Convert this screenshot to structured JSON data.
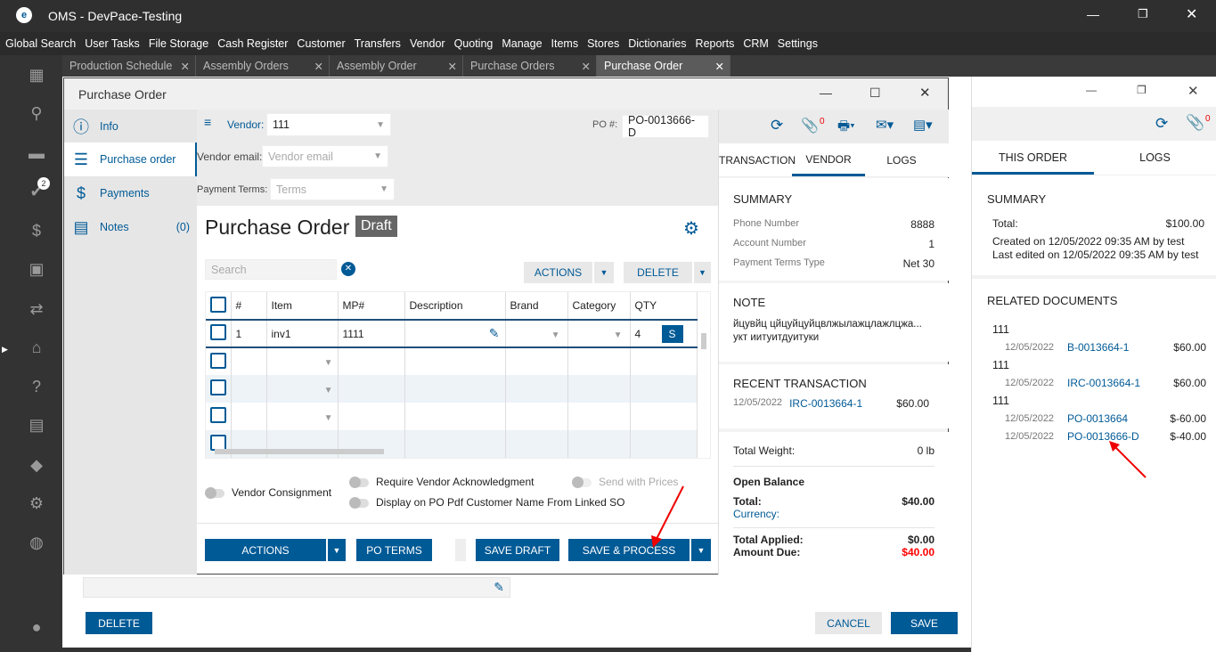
{
  "app": {
    "title": "OMS - DevPace-Testing"
  },
  "menu": [
    "Global Search",
    "User Tasks",
    "File Storage",
    "Cash Register",
    "Customer",
    "Transfers",
    "Vendor",
    "Quoting",
    "Manage",
    "Items",
    "Stores",
    "Dictionaries",
    "Reports",
    "CRM",
    "Settings"
  ],
  "tabs": [
    "Production Schedule",
    "Assembly Orders",
    "Assembly Order",
    "Purchase Orders",
    "Purchase Order"
  ],
  "notifications_badge": "2",
  "modal": {
    "title": "Purchase Order",
    "nav": {
      "info": "Info",
      "purchase_order": "Purchase order",
      "payments": "Payments",
      "notes": "Notes",
      "notes_count": "(0)"
    },
    "vendor_label": "Vendor:",
    "vendor_value": "111",
    "po_label": "PO #:",
    "po_value": "PO-0013666-D",
    "email_label": "Vendor email:",
    "email_placeholder": "Vendor email",
    "terms_label": "Payment Terms:",
    "terms_placeholder": "Terms",
    "heading": "Purchase Order",
    "status": "Draft",
    "search_placeholder": "Search",
    "actions": "ACTIONS",
    "delete": "DELETE",
    "columns": [
      "#",
      "Item",
      "MP#",
      "Description",
      "Brand",
      "Category",
      "QTY"
    ],
    "rows": [
      {
        "num": "1",
        "item": "inv1",
        "mp": "1111",
        "qty": "4",
        "s": "S"
      }
    ],
    "toggles": {
      "consignment": "Vendor Consignment",
      "ack": "Require Vendor Acknowledgment",
      "prices": "Send with Prices",
      "display": "Display on PO Pdf Customer Name From Linked SO"
    },
    "buttons": {
      "actions": "ACTIONS",
      "po_terms": "PO TERMS",
      "save_draft": "SAVE DRAFT",
      "save_process": "SAVE & PROCESS"
    },
    "attach_count": "0",
    "side_tabs": [
      "TRANSACTION",
      "VENDOR",
      "LOGS"
    ],
    "summary": {
      "title": "SUMMARY",
      "phone_label": "Phone Number",
      "phone": "8888",
      "account_label": "Account Number",
      "account": "1",
      "terms_label": "Payment Terms Type",
      "terms": "Net 30"
    },
    "note": {
      "title": "NOTE",
      "text": "йцувйц цйцуйцуйцвлжылажцлажлцжа... укт иитуитдуитуки"
    },
    "recent": {
      "title": "RECENT TRANSACTION",
      "date": "12/05/2022",
      "doc": "IRC-0013664-1",
      "amount": "$60.00"
    },
    "totals": {
      "weight_label": "Total Weight:",
      "weight": "0 lb",
      "open_balance": "Open Balance",
      "total_label": "Total:",
      "total": "$40.00",
      "currency_label": "Currency:",
      "applied_label": "Total Applied:",
      "applied": "$0.00",
      "due_label": "Amount Due:",
      "due": "$40.00"
    }
  },
  "page": {
    "delete": "DELETE",
    "cancel": "CANCEL",
    "save": "SAVE"
  },
  "right": {
    "attach_count": "0",
    "tabs": [
      "THIS ORDER",
      "LOGS"
    ],
    "summary_title": "SUMMARY",
    "total_label": "Total:",
    "total": "$100.00",
    "created": "Created on 12/05/2022 09:35 AM by test",
    "edited": "Last edited on 12/05/2022 09:35 AM by test",
    "related_title": "RELATED DOCUMENTS",
    "groups": [
      {
        "vendor": "111",
        "docs": [
          {
            "date": "12/05/2022",
            "doc": "B-0013664-1",
            "amount": "$60.00"
          }
        ]
      },
      {
        "vendor": "111",
        "docs": [
          {
            "date": "12/05/2022",
            "doc": "IRC-0013664-1",
            "amount": "$60.00"
          }
        ]
      },
      {
        "vendor": "111",
        "docs": [
          {
            "date": "12/05/2022",
            "doc": "PO-0013664",
            "amount": "$-60.00"
          },
          {
            "date": "12/05/2022",
            "doc": "PO-0013666-D",
            "amount": "$-40.00"
          }
        ]
      }
    ]
  },
  "colors": {
    "accent": "#005a96",
    "danger": "#ff0000",
    "arrow": "#e00000"
  }
}
